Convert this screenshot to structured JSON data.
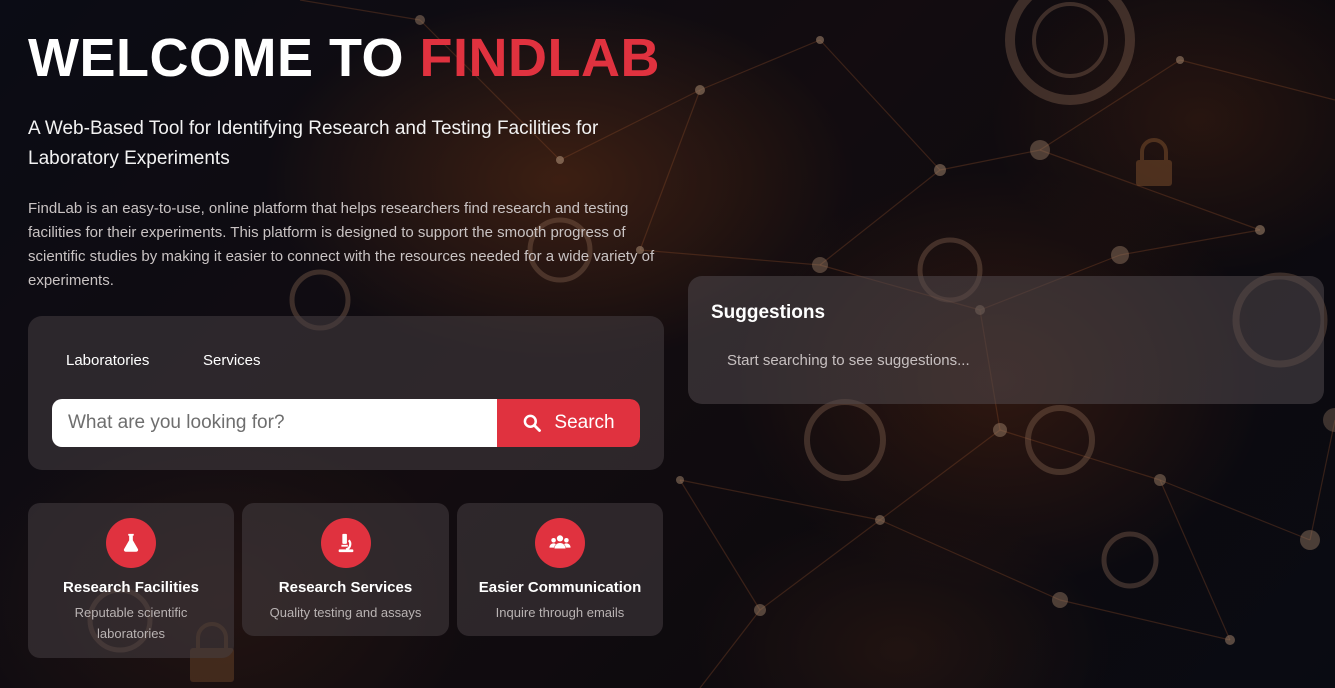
{
  "hero": {
    "title_prefix": "WELCOME TO ",
    "title_brand": "FINDLAB",
    "subtitle": "A Web-Based Tool for Identifying Research and Testing Facilities for Laboratory Experiments",
    "description": "FindLab is an easy-to-use, online platform that helps researchers find research and testing facilities for their experiments. This platform is designed to support the smooth progress of scientific studies by making it easier to connect with the resources needed for a wide variety of experiments."
  },
  "search": {
    "tabs": [
      {
        "label": "Laboratories"
      },
      {
        "label": "Services"
      }
    ],
    "placeholder": "What are you looking for?",
    "button_label": "Search"
  },
  "features": [
    {
      "icon": "flask-icon",
      "title": "Research Facilities",
      "subtitle": "Reputable scientific laboratories"
    },
    {
      "icon": "microscope-icon",
      "title": "Research Services",
      "subtitle": "Quality testing and assays"
    },
    {
      "icon": "users-icon",
      "title": "Easier Communication",
      "subtitle": "Inquire through emails"
    }
  ],
  "suggestions": {
    "title": "Suggestions",
    "empty_text": "Start searching to see suggestions..."
  },
  "colors": {
    "accent": "#e0323f",
    "background": "#12101a"
  }
}
